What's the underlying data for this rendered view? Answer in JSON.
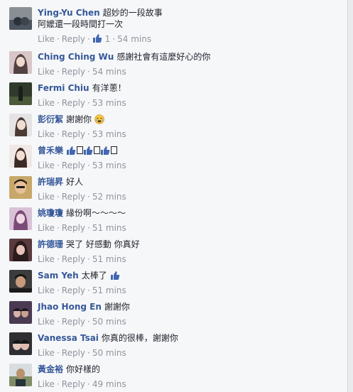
{
  "actions": {
    "like": "Like",
    "reply": "Reply",
    "separator": "·"
  },
  "comments": [
    {
      "author": "Ying-Yu Chen",
      "text": "超妙的一段故事",
      "text2": "阿嬤還一段時間打一次",
      "likes": "1",
      "time": "54 mins"
    },
    {
      "author": "Ching Ching Wu",
      "text": "感謝社會有這麼好心的你",
      "time": "54 mins"
    },
    {
      "author": "Fermi Chiu",
      "text": "有洋蔥！",
      "time": "53 mins"
    },
    {
      "author": "彭衍絜",
      "text": "謝謝你",
      "time": "53 mins"
    },
    {
      "author": "曾禾樂",
      "text": "",
      "time": "53 mins"
    },
    {
      "author": "許瑞昇",
      "text": "好人",
      "time": "52 mins"
    },
    {
      "author": "姚瓊瓊",
      "text": "緣份啊～～～～",
      "time": "51 mins"
    },
    {
      "author": "許德珊",
      "text": "哭了 好感動 你真好",
      "time": "51 mins"
    },
    {
      "author": "Sam Yeh",
      "text": "太棒了",
      "time": "51 mins"
    },
    {
      "author": "Jhao Hong En",
      "text": "謝謝你",
      "time": "50 mins"
    },
    {
      "author": "Vanessa Tsai",
      "text": "你真的很棒，謝謝你",
      "time": "50 mins"
    },
    {
      "author": "黃金裕",
      "text": "你好樣的",
      "time": "49 mins"
    }
  ],
  "colors": {
    "link": "#365899",
    "meta": "#90949c",
    "text": "#1d2129",
    "like_blue": "#4267b2"
  }
}
